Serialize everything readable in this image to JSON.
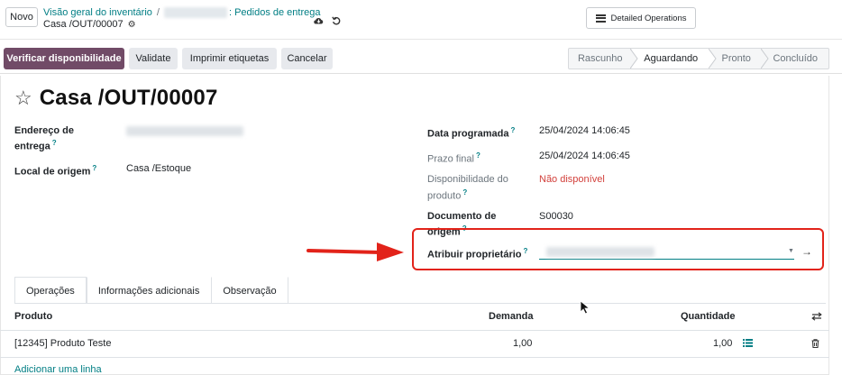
{
  "control_panel": {
    "new_button": "Novo",
    "breadcrumb_root": "Visão geral do inventário",
    "breadcrumb_separator": "/",
    "breadcrumb_section": ": Pedidos de entrega",
    "record_name": "Casa /OUT/00007",
    "detailed_operations": "Detailed Operations"
  },
  "actions": {
    "check_availability": "Verificar disponibilidade",
    "validate": "Validate",
    "print_labels": "Imprimir etiquetas",
    "cancel": "Cancelar"
  },
  "stages": [
    {
      "label": "Rascunho",
      "active": false
    },
    {
      "label": "Aguardando",
      "active": true
    },
    {
      "label": "Pronto",
      "active": false
    },
    {
      "label": "Concluído",
      "active": false
    }
  ],
  "form": {
    "title": "Casa /OUT/00007",
    "delivery_address_label_1": "Endereço de",
    "delivery_address_label_2": "entrega",
    "source_location_label": "Local de origem",
    "source_location_value": "Casa /Estoque",
    "scheduled_date_label": "Data programada",
    "scheduled_date_value": "25/04/2024 14:06:45",
    "deadline_label": "Prazo final",
    "deadline_value": "25/04/2024 14:06:45",
    "availability_label_1": "Disponibilidade do",
    "availability_label_2": "produto",
    "availability_value": "Não disponível",
    "origin_doc_label_1": "Documento de",
    "origin_doc_label_2": "origem",
    "origin_doc_value": "S00030",
    "assign_owner_label": "Atribuir proprietário",
    "help_mark": "?"
  },
  "tabs": [
    {
      "label": "Operações",
      "active": true
    },
    {
      "label": "Informações adicionais",
      "active": false
    },
    {
      "label": "Observação",
      "active": false
    }
  ],
  "table": {
    "columns": [
      "Produto",
      "Demanda",
      "Quantidade"
    ],
    "rows": [
      {
        "product": "[12345] Produto Teste",
        "demand": "1,00",
        "quantity": "1,00"
      }
    ],
    "add_line": "Adicionar uma linha"
  },
  "colors": {
    "primary": "#714b67",
    "link": "#017e84",
    "danger": "#d23f3a",
    "annotation": "#e2231a"
  }
}
